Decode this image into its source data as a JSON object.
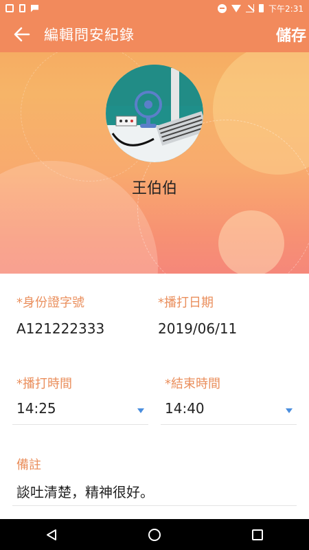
{
  "status_bar": {
    "time": "下午2:31"
  },
  "header": {
    "title": "編輯問安紀錄",
    "save_label": "儲存",
    "accent_color": "#f28a5c"
  },
  "profile": {
    "name": "王伯伯"
  },
  "form": {
    "id_number": {
      "label": "*身份證字號",
      "value": "A121222333"
    },
    "call_date": {
      "label": "*播打日期",
      "value": "2019/06/11"
    },
    "call_time": {
      "label": "*播打時間",
      "value": "14:25"
    },
    "end_time": {
      "label": "*結束時間",
      "value": "14:40"
    },
    "note": {
      "label": "備註",
      "value": "談吐清楚，精神很好。"
    }
  },
  "navigation": {
    "back_icon": "back-triangle-icon",
    "home_icon": "home-circle-icon",
    "recents_icon": "recents-square-icon"
  }
}
